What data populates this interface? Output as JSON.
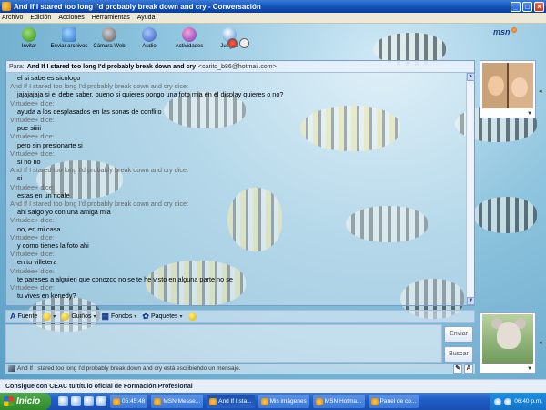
{
  "window": {
    "title": "And If I stared too long I'd probably break down and cry - Conversación",
    "buttons": {
      "minimize": "_",
      "maximize": "□",
      "close": "×"
    }
  },
  "menu": [
    "Archivo",
    "Edición",
    "Acciones",
    "Herramientas",
    "Ayuda"
  ],
  "toolbar": {
    "buttons": [
      {
        "label": "Invitar",
        "icon": "invite-icon"
      },
      {
        "label": "Enviar archivos",
        "icon": "send-files-icon"
      },
      {
        "label": "Cámara Web",
        "icon": "webcam-icon"
      },
      {
        "label": "Audio",
        "icon": "audio-icon"
      },
      {
        "label": "Actividades",
        "icon": "activities-icon"
      },
      {
        "label": "Juegos",
        "icon": "games-icon"
      }
    ],
    "logo": "msn"
  },
  "conversation": {
    "to_label": "Para:",
    "to_name": "And If I stared too long I'd probably break down and cry",
    "to_email": "<carito_b86@hotmail.com>",
    "messages": [
      {
        "type": "text",
        "text": "el si sabe es sicologo"
      },
      {
        "type": "sender",
        "text": "And If I stared too long I'd probably break down and cry dice:"
      },
      {
        "type": "text",
        "text": "jajajajaja si el debe saber, bueno si quieres pongo una foto mia en el display quieres o no?"
      },
      {
        "type": "sender",
        "text": "Virtudee+ dice:"
      },
      {
        "type": "text",
        "text": "ayuda a los desplasados en las sonas de conflito"
      },
      {
        "type": "sender",
        "text": "Virtudee+ dice:"
      },
      {
        "type": "text",
        "text": "pue siiiii"
      },
      {
        "type": "sender",
        "text": "Virtudee+ dice:"
      },
      {
        "type": "text",
        "text": "pero sin presionarte si"
      },
      {
        "type": "sender",
        "text": "Virtudee+ dice:"
      },
      {
        "type": "text",
        "text": "si no no"
      },
      {
        "type": "sender",
        "text": "And If I stared too long I'd probably break down and cry dice:"
      },
      {
        "type": "text",
        "text": "si"
      },
      {
        "type": "sender",
        "text": "Virtudee+ dice:"
      },
      {
        "type": "text",
        "text": "estas en un ricafe"
      },
      {
        "type": "sender",
        "text": "And If I stared too long I'd probably break down and cry dice:"
      },
      {
        "type": "text",
        "text": "ahi salgo yo con una amiga mia"
      },
      {
        "type": "sender",
        "text": "Virtudee+ dice:"
      },
      {
        "type": "text",
        "text": "no, en mi casa"
      },
      {
        "type": "sender",
        "text": "Virtudee+ dice:"
      },
      {
        "type": "text",
        "text": "y como tienes la foto ahi"
      },
      {
        "type": "sender",
        "text": "Virtudee+ dice:"
      },
      {
        "type": "text",
        "text": "en tu villetera"
      },
      {
        "type": "sender",
        "text": "Virtudee+ dice:"
      },
      {
        "type": "text",
        "text": "te pareses a alguien que conozco no se te he visto en alguna parte no se"
      },
      {
        "type": "sender",
        "text": "Virtudee+ dice:"
      },
      {
        "type": "text",
        "text": "tu vives en kenedy?"
      }
    ]
  },
  "format_bar": [
    {
      "label": "Fuente",
      "icon": "font-icon",
      "dropdown": false
    },
    {
      "label": "",
      "icon": "emoticon-icon",
      "dropdown": true
    },
    {
      "label": "Guiños",
      "icon": "wink-icon",
      "dropdown": true
    },
    {
      "label": "Fondos",
      "icon": "backgrounds-icon",
      "dropdown": true
    },
    {
      "label": "Paquetes",
      "icon": "packs-icon",
      "dropdown": true
    }
  ],
  "buttons": {
    "send": "Enviar",
    "search": "Buscar"
  },
  "status": "And If I stared too long I'd probably break down and cry está escribiendo un mensaje.",
  "ad": "Consigue con CEAC tu título oficial de Formación Profesional",
  "taskbar": {
    "start": "Inicio",
    "tasks": [
      {
        "label": "05:45:48"
      },
      {
        "label": "MSN Messe..."
      },
      {
        "label": "And If I sta...",
        "active": true
      },
      {
        "label": "Mis imágenes"
      },
      {
        "label": "MSN Hotma..."
      },
      {
        "label": "Panel de co..."
      }
    ],
    "clock": "06:40 p.m."
  }
}
